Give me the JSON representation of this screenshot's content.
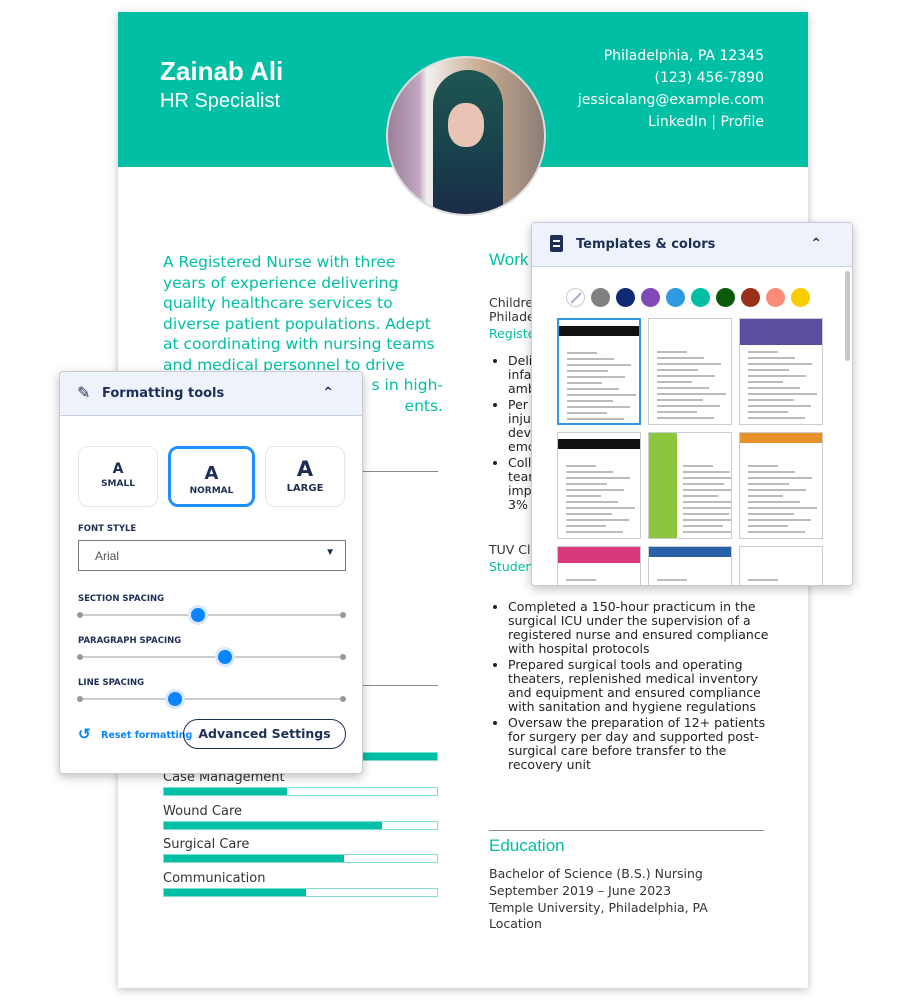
{
  "resume": {
    "name": "Zainab Ali",
    "title": "HR Specialist",
    "contact": {
      "address": "Philadelphia, PA 12345",
      "phone": "(123) 456-7890",
      "email": "jessicalang@example.com",
      "linkedin": "LinkedIn",
      "separator": "|",
      "profile": "Profile"
    },
    "summary_lines": [
      "A Registered Nurse with three",
      "years of experience delivering",
      "quality healthcare services to",
      "diverse patient populations. Adept",
      "at coordinating with nursing teams",
      "and medical personnel to drive",
      "s in high-",
      "ents."
    ],
    "skills": [
      {
        "label": "",
        "level": 1.0
      },
      {
        "label": "Case Management",
        "level": 0.45
      },
      {
        "label": "Wound Care",
        "level": 0.8
      },
      {
        "label": "Surgical Care",
        "level": 0.66
      },
      {
        "label": "Communication",
        "level": 0.52
      }
    ],
    "work": {
      "heading": "Work",
      "job1": {
        "employer": "Childre",
        "location": "Philade",
        "role": "Registe",
        "bullets": [
          [
            "Deli",
            "infa",
            "amb"
          ],
          [
            "Per",
            "inju",
            "dev",
            "emc"
          ],
          [
            "Coll",
            "tear",
            "imp",
            "3%"
          ]
        ]
      },
      "job2": {
        "employer": "TUV Cl",
        "role": "Studen",
        "bullets": [
          "Completed a 150-hour practicum in the surgical ICU under the supervision of a registered nurse and ensured compliance with hospital protocols",
          "Prepared surgical tools and operating theaters, replenished medical inventory and equipment and ensured compliance with sanitation and hygiene regulations",
          "Oversaw the preparation of 12+ patients for surgery per day and supported post-surgical care before transfer to the recovery unit"
        ]
      }
    },
    "education": {
      "heading": "Education",
      "degree": "Bachelor of Science (B.S.) Nursing",
      "dates": "September 2019 – June 2023",
      "school": "Temple University, Philadelphia, PA",
      "location": "Location"
    }
  },
  "templates_panel": {
    "title": "Templates & colors",
    "icon": "document-icon",
    "collapse_icon": "chevron-up-icon",
    "colors": [
      "none",
      "#808080",
      "#0f2a73",
      "#7f4ab8",
      "#2e9be0",
      "#00bfa5",
      "#0a5a0a",
      "#9a3018",
      "#fa8c78",
      "#fbcd00"
    ],
    "templates": [
      {
        "accent": "#111111",
        "selected": true
      },
      {
        "accent": "#a8c86a"
      },
      {
        "accent": "#5b4d9f"
      },
      {
        "accent": "#111111"
      },
      {
        "accent": "#8cc63f"
      },
      {
        "accent": "#e8902a"
      },
      {
        "accent": "#d9397a"
      },
      {
        "accent": "#2760a8"
      },
      {
        "accent": "#dddddd"
      }
    ]
  },
  "formatting_panel": {
    "title": "Formatting tools",
    "icon": "tools-icon",
    "collapse_icon": "chevron-up-icon",
    "sizes": [
      {
        "glyph": "A",
        "label": "SMALL"
      },
      {
        "glyph": "A",
        "label": "NORMAL",
        "selected": true
      },
      {
        "glyph": "A",
        "label": "LARGE"
      }
    ],
    "font_style_label": "FONT STYLE",
    "font_style_value": "Arial",
    "sliders": [
      {
        "label": "SECTION SPACING",
        "value": 0.45
      },
      {
        "label": "PARAGRAPH SPACING",
        "value": 0.55
      },
      {
        "label": "LINE SPACING",
        "value": 0.36
      }
    ],
    "reset_label": "Reset formatting",
    "advanced_label": "Advanced Settings"
  }
}
